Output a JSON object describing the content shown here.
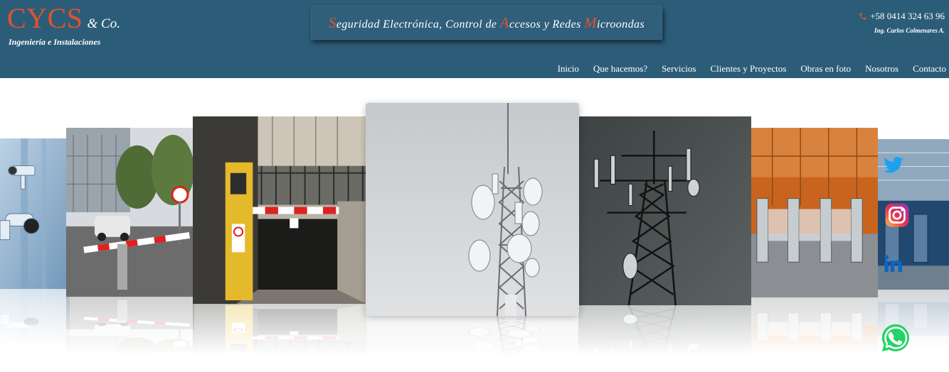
{
  "brand": {
    "name": "CYCS",
    "suffix": "& Co.",
    "subtitle": "Ingeniería e Instalaciones"
  },
  "tagline": {
    "parts": [
      {
        "cap": "S",
        "rest": "eguridad Electrónica, Control de "
      },
      {
        "cap": "A",
        "rest": "ccesos y Redes "
      },
      {
        "cap": "M",
        "rest": "icroondas"
      }
    ]
  },
  "contact": {
    "phone": "+58 0414 324 63 96",
    "engineer": "Ing. Carlos Colmenares A."
  },
  "nav": {
    "items": [
      "Inicio",
      "Que hacemos?",
      "Servicios",
      "Clientes y Proyectos",
      "Obras en foto",
      "Nosotros",
      "Contacto"
    ]
  },
  "carousel": {
    "slides": [
      "security-cameras",
      "parking-barrier",
      "garage-barrier",
      "antenna-tower",
      "dark-antenna-tower",
      "turnstiles",
      "station-gates"
    ]
  },
  "social": [
    "twitter-icon",
    "instagram-icon",
    "linkedin-icon",
    "whatsapp-icon"
  ],
  "colors": {
    "header_bg": "#2c5d78",
    "brand_accent": "#e2522b",
    "nav_text": "#ffffff"
  }
}
